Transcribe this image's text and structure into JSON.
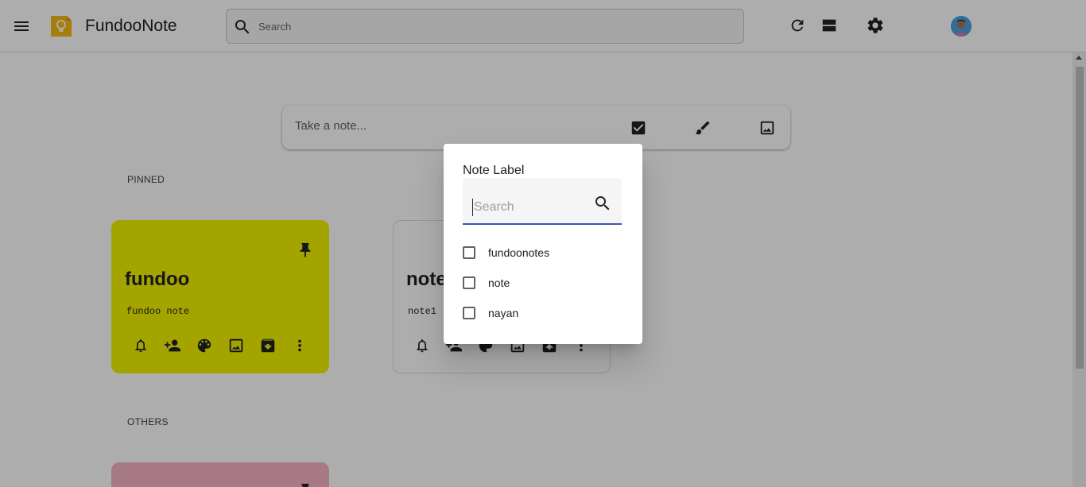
{
  "app": {
    "title": "FundooNote"
  },
  "header": {
    "search_placeholder": "Search",
    "icons": [
      "menu-icon",
      "refresh-icon",
      "list-view-icon",
      "settings-icon",
      "avatar"
    ]
  },
  "take_note": {
    "placeholder": "Take a note...",
    "icons": [
      "checkbox-icon",
      "brush-icon",
      "image-icon"
    ]
  },
  "sections": {
    "pinned": "PINNED",
    "others": "OTHERS"
  },
  "notes": [
    {
      "title": "fundoo",
      "body": "fundoo note",
      "color": "#f2f200",
      "pinned": true
    },
    {
      "title": "note",
      "body": "note1",
      "color": "#ffffff",
      "pinned": true
    },
    {
      "title": "",
      "body": "",
      "color": "#f5b3c4",
      "pinned": false
    }
  ],
  "note_action_icons": [
    "reminder-icon",
    "collaborator-icon",
    "palette-icon",
    "image-icon",
    "archive-icon",
    "more-icon"
  ],
  "dialog": {
    "title": "Note Label",
    "search_placeholder": "Search",
    "labels": [
      {
        "name": "fundoonotes",
        "checked": false
      },
      {
        "name": "note",
        "checked": false
      },
      {
        "name": "nayan",
        "checked": false
      }
    ]
  },
  "colors": {
    "accent": "#3f51b5",
    "logo": "#f5ba14"
  }
}
